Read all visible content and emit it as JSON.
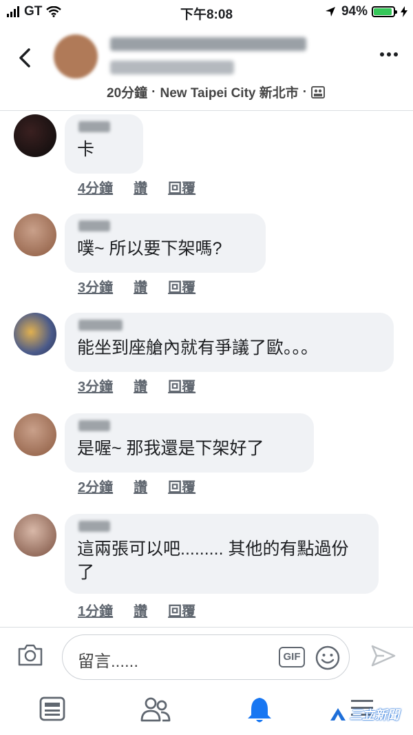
{
  "status_bar": {
    "carrier": "GT",
    "time": "下午8:08",
    "battery_percent": "94%",
    "battery_level": 0.94
  },
  "header": {
    "meta_time": "20分鐘",
    "meta_location": "New Taipei City 新北市",
    "separator": "·"
  },
  "comments": [
    {
      "text": "卡",
      "time": "4分鐘",
      "like": "讚",
      "reply": "回覆"
    },
    {
      "text": "噗~ 所以要下架嗎?",
      "time": "3分鐘",
      "like": "讚",
      "reply": "回覆"
    },
    {
      "text": "能坐到座艙內就有爭議了歐。。。",
      "time": "3分鐘",
      "like": "讚",
      "reply": "回覆"
    },
    {
      "text": "是喔~ 那我還是下架好了",
      "time": "2分鐘",
      "like": "讚",
      "reply": "回覆"
    },
    {
      "text": "這兩張可以吧......... 其他的有點過份了",
      "time": "1分鐘",
      "like": "讚",
      "reply": "回覆"
    }
  ],
  "composer": {
    "placeholder": "留言......",
    "gif_label": "GIF"
  },
  "watermark": {
    "text": "三立新聞"
  },
  "colors": {
    "bubble": "#f0f2f5",
    "link_gray": "#606770",
    "facebook_blue": "#1877f2",
    "battery_green": "#35c759"
  },
  "icons": [
    "back-chevron-icon",
    "more-dots-icon",
    "camera-icon",
    "emoji-icon",
    "send-icon",
    "news-feed-icon",
    "friends-icon",
    "notifications-bell-icon",
    "menu-icon"
  ]
}
